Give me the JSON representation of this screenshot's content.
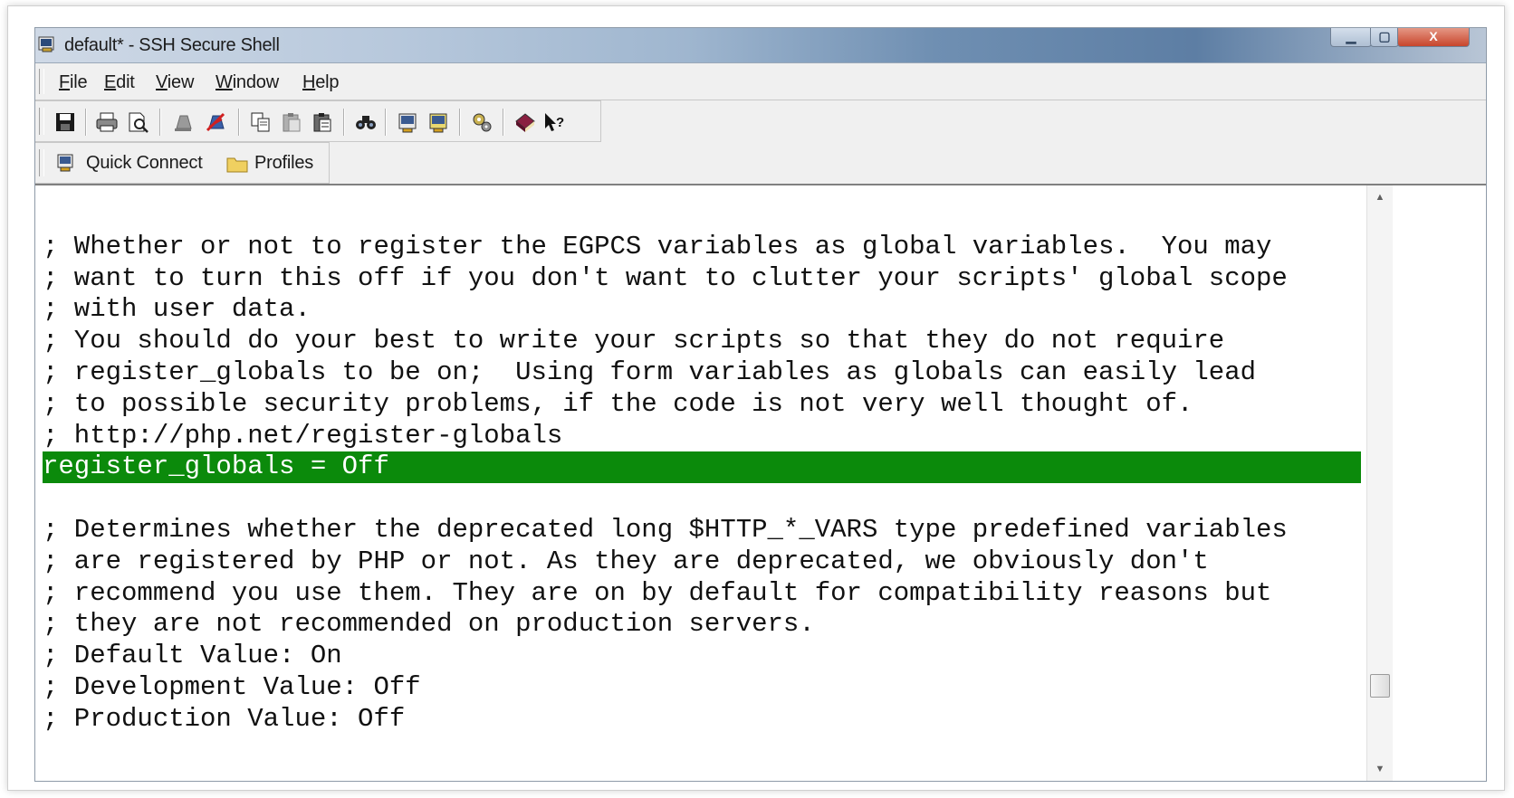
{
  "window": {
    "title": "default* - SSH Secure Shell",
    "min_glyph": "▁",
    "max_glyph": "▢",
    "close_glyph": "X"
  },
  "menu": {
    "items": [
      "File",
      "Edit",
      "View",
      "Window",
      "Help"
    ]
  },
  "toolbar": {
    "icons": [
      "save-icon",
      "print-icon",
      "print-preview-icon",
      "disconnect-icon",
      "connect-icon",
      "copy-icon",
      "paste-icon",
      "paste-special-icon",
      "find-icon",
      "settings-icon",
      "settings-save-icon",
      "sftp-icon",
      "help-book-icon",
      "whats-this-icon"
    ]
  },
  "quickbar": {
    "quick_connect": "Quick Connect",
    "profiles": "Profiles"
  },
  "terminal": {
    "highlight_color": "#0b8a0b",
    "lines": [
      "",
      "; Whether or not to register the EGPCS variables as global variables.  You may",
      "; want to turn this off if you don't want to clutter your scripts' global scope",
      "; with user data.",
      "; You should do your best to write your scripts so that they do not require",
      "; register_globals to be on;  Using form variables as globals can easily lead",
      "; to possible security problems, if the code is not very well thought of.",
      "; http://php.net/register-globals",
      "register_globals = Off",
      "",
      "; Determines whether the deprecated long $HTTP_*_VARS type predefined variables",
      "; are registered by PHP or not. As they are deprecated, we obviously don't",
      "; recommend you use them. They are on by default for compatibility reasons but",
      "; they are not recommended on production servers.",
      "; Default Value: On",
      "; Development Value: Off",
      "; Production Value: Off"
    ],
    "highlighted_line_index": 8
  }
}
